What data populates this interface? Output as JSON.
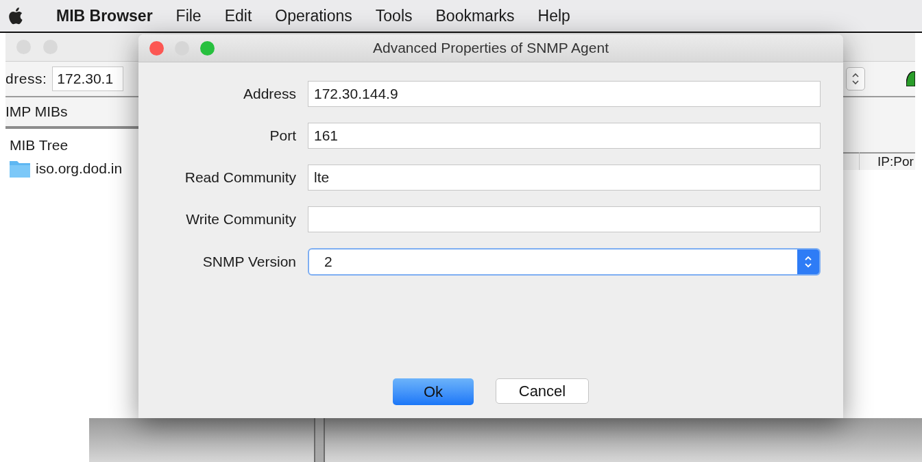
{
  "menu_bar": {
    "app_name": "MIB Browser",
    "items": [
      "File",
      "Edit",
      "Operations",
      "Tools",
      "Bookmarks",
      "Help"
    ]
  },
  "main_window": {
    "address_label": "dress:",
    "address_value": "172.30.1",
    "tab": "IMP MIBs",
    "tree": {
      "label": "MIB Tree",
      "children": [
        {
          "label": "iso.org.dod.in"
        }
      ]
    },
    "column_header": "IP:Por"
  },
  "dialog": {
    "title": "Advanced Properties of SNMP Agent",
    "fields": [
      {
        "label": "Address",
        "kind": "text",
        "value": "172.30.144.9"
      },
      {
        "label": "Port",
        "kind": "text",
        "value": "161"
      },
      {
        "label": "Read Community",
        "kind": "text",
        "value": "lte"
      },
      {
        "label": "Write Community",
        "kind": "text"
      },
      {
        "label": "SNMP Version",
        "kind": "select",
        "value": "2"
      }
    ],
    "buttons": [
      {
        "label": "Ok",
        "default": true
      },
      {
        "label": "Cancel",
        "default": false
      }
    ]
  }
}
